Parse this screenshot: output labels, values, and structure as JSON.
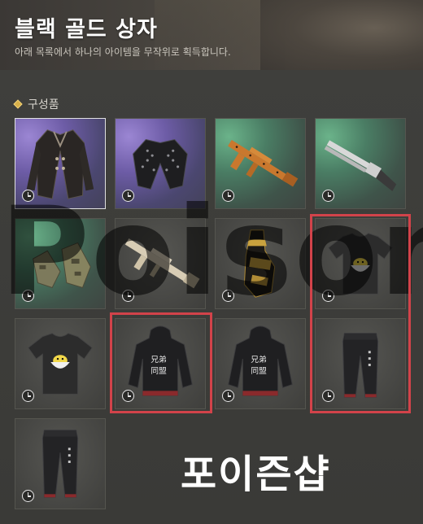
{
  "header": {
    "title": "블랙 골드 상자",
    "subtitle": "아래 목록에서 하나의 아이템을 무작위로 획득합니다."
  },
  "section": {
    "label": "구성품"
  },
  "items": [
    {
      "name": "black-trench-coat",
      "bg": "purple",
      "selected": true
    },
    {
      "name": "studded-leather-jacket",
      "bg": "purple",
      "selected": false
    },
    {
      "name": "orange-assault-rifle",
      "bg": "green",
      "selected": false
    },
    {
      "name": "silver-shotgun",
      "bg": "green",
      "selected": false
    },
    {
      "name": "camo-gloves",
      "bg": "green",
      "selected": false
    },
    {
      "name": "beige-rifle",
      "bg": "gray",
      "selected": false
    },
    {
      "name": "gold-black-gloves",
      "bg": "gray",
      "selected": false
    },
    {
      "name": "chick-tshirt",
      "bg": "gray",
      "selected": false
    },
    {
      "name": "chick-tshirt-2",
      "bg": "gray",
      "selected": false
    },
    {
      "name": "black-hoodie",
      "bg": "gray",
      "selected": false
    },
    {
      "name": "black-hoodie-2",
      "bg": "gray",
      "selected": false
    },
    {
      "name": "black-pants",
      "bg": "gray",
      "selected": false
    },
    {
      "name": "black-pants-2",
      "bg": "gray",
      "selected": false
    }
  ],
  "watermark": "Poison",
  "shop_label": "포이즌샵",
  "colors": {
    "highlight": "#d2434a",
    "accent": "#d8b04a"
  }
}
